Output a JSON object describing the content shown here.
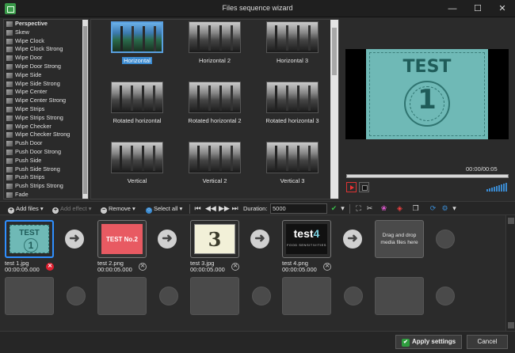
{
  "window": {
    "title": "Files sequence wizard",
    "minimize": "—",
    "maximize": "☐",
    "close": "✕"
  },
  "effects": [
    "Perspective",
    "Skew",
    "Wipe Clock",
    "Wipe Clock Strong",
    "Wipe Door",
    "Wipe Door Strong",
    "Wipe Side",
    "Wipe Side Strong",
    "Wipe Center",
    "Wipe Center Strong",
    "Wipe Strips",
    "Wipe Strips Strong",
    "Wipe Checker",
    "Wipe Checker Strong",
    "Push Door",
    "Push Door Strong",
    "Push Side",
    "Push Side Strong",
    "Push Strips",
    "Push Strips Strong",
    "Fade"
  ],
  "transitions": [
    "Horizontal",
    "Horizontal 2",
    "Horizontal 3",
    "Rotated horizontal",
    "Rotated horizontal 2",
    "Rotated horizontal 3",
    "Vertical",
    "Vertical 2",
    "Vertical 3"
  ],
  "preview": {
    "card_title": "TEST",
    "card_number": "1",
    "time": "00:00/00:05"
  },
  "toolbar": {
    "add_files": "Add files",
    "add_effect": "Add effect",
    "remove": "Remove",
    "select_all": "Select all",
    "duration_label": "Duration:",
    "duration_value": "5000"
  },
  "slides": [
    {
      "file": "test 1.jpg",
      "time": "00:00:05.000",
      "title": "TEST",
      "number": "1"
    },
    {
      "file": "test 2.png",
      "time": "00:00:05.000",
      "text": "TEST No.2"
    },
    {
      "file": "test 3.jpg",
      "time": "00:00:05.000",
      "text": "3"
    },
    {
      "file": "test 4.png",
      "time": "00:00:05.000",
      "big": "test",
      "big_num": "4",
      "small": "FOOD SENSITIVITIES"
    }
  ],
  "dropzone": {
    "line1": "Drag and drop",
    "line2": "media files here"
  },
  "footer": {
    "apply": "Apply settings",
    "cancel": "Cancel"
  }
}
